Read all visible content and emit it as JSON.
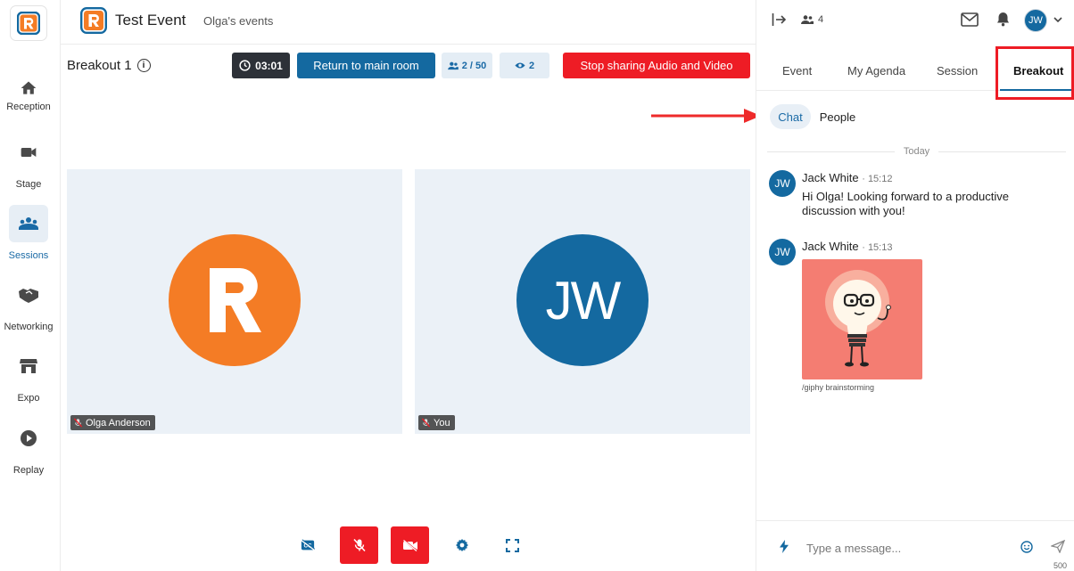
{
  "nav": {
    "items": [
      {
        "label": "Reception",
        "icon": "home-icon"
      },
      {
        "label": "Stage",
        "icon": "video-camera-icon"
      },
      {
        "label": "Sessions",
        "icon": "group-icon"
      },
      {
        "label": "Networking",
        "icon": "handshake-icon"
      },
      {
        "label": "Expo",
        "icon": "store-icon"
      },
      {
        "label": "Replay",
        "icon": "play-circle-icon"
      }
    ],
    "active": "Sessions"
  },
  "header": {
    "title": "Test Event",
    "subtitle": "Olga's events"
  },
  "toolbar": {
    "room_title": "Breakout 1",
    "timer": "03:01",
    "return_label": "Return to main room",
    "participants": "2 / 50",
    "viewers": "2",
    "stop_label": "Stop sharing Audio and Video"
  },
  "tiles": [
    {
      "name": "Olga Anderson",
      "avatar": "R",
      "color": "#f47c25"
    },
    {
      "name": "You",
      "avatar": "JW",
      "color": "#1469a0"
    }
  ],
  "panel": {
    "attendee_count": "4",
    "user_initials": "JW",
    "tabs": [
      "Event",
      "My Agenda",
      "Session",
      "Breakout"
    ],
    "active_tab": "Breakout",
    "subtabs": [
      "Chat",
      "People"
    ],
    "active_subtab": "Chat",
    "day_divider": "Today",
    "messages": [
      {
        "author": "Jack White",
        "time": "15:12",
        "initials": "JW",
        "text": "Hi Olga! Looking forward to a productive discussion with you!"
      },
      {
        "author": "Jack White",
        "time": "15:13",
        "initials": "JW",
        "caption": "/giphy brainstorming"
      }
    ],
    "composer": {
      "placeholder": "Type a message...",
      "char_count": "500"
    }
  },
  "colors": {
    "brand_blue": "#1469a0",
    "brand_orange": "#f47c25",
    "danger_red": "#ee1c25",
    "tile_bg": "#ebf1f7"
  }
}
